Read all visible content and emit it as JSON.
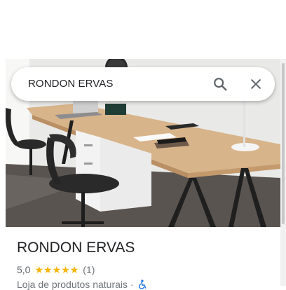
{
  "search": {
    "query": "RONDON ERVAS"
  },
  "icons": {
    "search": "search-icon",
    "close": "close-icon",
    "accessibility": "wheelchair-icon"
  },
  "place": {
    "name": "RONDON ERVAS",
    "rating_text": "5,0",
    "rating": 5.0,
    "max_rating": 5,
    "review_count_text": "(1)",
    "category": "Loja de produtos naturais",
    "separator": "·"
  },
  "colors": {
    "star": "#f5b400",
    "accessibility": "#1a73e8",
    "text_primary": "#202124",
    "text_secondary": "#70757a"
  }
}
